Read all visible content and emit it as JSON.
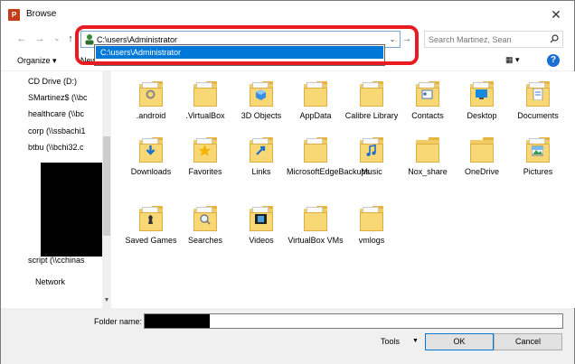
{
  "window": {
    "title": "Browse",
    "app_icon": "P"
  },
  "nav": {
    "address_value": "C:\\users\\Administrator",
    "search_placeholder": "Search Martinez, Sean"
  },
  "suggestion": {
    "item": "C:\\users\\Administrator"
  },
  "toolbar": {
    "organize": "Organize",
    "new_folder": "New"
  },
  "sidebar": {
    "items": [
      {
        "label": "CD Drive (D:)",
        "icon": "cd-drive-icon"
      },
      {
        "label": "SMartinez$ (\\\\bc",
        "icon": "network-drive-icon"
      },
      {
        "label": "healthcare (\\\\bc",
        "icon": "network-drive-icon"
      },
      {
        "label": "corp (\\\\ssbachi1",
        "icon": "network-drive-icon"
      },
      {
        "label": "btbu (\\\\bchi32.c",
        "icon": "network-drive-icon"
      },
      {
        "label": "script (\\\\cchinas",
        "icon": "network-drive-icon"
      },
      {
        "label": "Network",
        "icon": "network-icon"
      }
    ]
  },
  "files": [
    {
      "label": ".android",
      "badge": "gear"
    },
    {
      "label": ".VirtualBox",
      "badge": "paper"
    },
    {
      "label": "3D Objects",
      "badge": "cube"
    },
    {
      "label": "AppData",
      "badge": "paper"
    },
    {
      "label": "Calibre Library",
      "badge": "paper"
    },
    {
      "label": "Contacts",
      "badge": "contact"
    },
    {
      "label": "Desktop",
      "badge": "desktop"
    },
    {
      "label": "Documents",
      "badge": "doc"
    },
    {
      "label": "Downloads",
      "badge": "down"
    },
    {
      "label": "Favorites",
      "badge": "star"
    },
    {
      "label": "Links",
      "badge": "link"
    },
    {
      "label": "MicrosoftEdgeBackups",
      "badge": "paper"
    },
    {
      "label": "Music",
      "badge": "note"
    },
    {
      "label": "Nox_share",
      "badge": "none"
    },
    {
      "label": "OneDrive",
      "badge": "none"
    },
    {
      "label": "Pictures",
      "badge": "picture"
    },
    {
      "label": "Saved Games",
      "badge": "chess"
    },
    {
      "label": "Searches",
      "badge": "search"
    },
    {
      "label": "Videos",
      "badge": "film"
    },
    {
      "label": "VirtualBox VMs",
      "badge": "paper"
    },
    {
      "label": "vmlogs",
      "badge": "paper"
    }
  ],
  "footer": {
    "folder_name_label": "Folder name:",
    "tools": "Tools",
    "ok": "OK",
    "cancel": "Cancel"
  },
  "colors": {
    "highlight": "#e81b23",
    "selection": "#0078d7",
    "folder": "#f8d775"
  }
}
